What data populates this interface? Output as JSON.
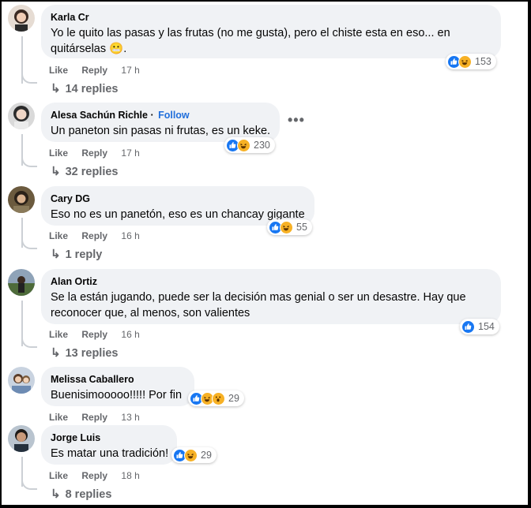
{
  "comments": [
    {
      "author": "Karla Cr",
      "text_line1": "Yo le quito las pasas y las frutas (no me gusta), pero el chiste esta en eso... en",
      "text_line2": "quitárselas 😬.",
      "like_label": "Like",
      "reply_label": "Reply",
      "time": "17 h",
      "reaction_count": "153",
      "reactions": [
        "like-icon",
        "haha-icon"
      ],
      "replies_label": "14 replies"
    },
    {
      "author": "Alesa Sachún Richle",
      "follow_label": "Follow",
      "text_line1": "Un paneton sin pasas ni frutas, es un keke.",
      "like_label": "Like",
      "reply_label": "Reply",
      "time": "17 h",
      "reaction_count": "230",
      "reactions": [
        "like-icon",
        "haha-icon"
      ],
      "replies_label": "32 replies",
      "more_label": "•••"
    },
    {
      "author": "Cary DG",
      "text_line1": "Eso no es un panetón, eso es un chancay gigante",
      "like_label": "Like",
      "reply_label": "Reply",
      "time": "16 h",
      "reaction_count": "55",
      "reactions": [
        "like-icon",
        "haha-icon"
      ],
      "replies_label": "1 reply"
    },
    {
      "author": "Alan Ortiz",
      "text_line1": "Se la están jugando, puede ser la decisión mas genial o ser un desastre. Hay que",
      "text_line2": "reconocer que, al menos, son valientes",
      "like_label": "Like",
      "reply_label": "Reply",
      "time": "16 h",
      "reaction_count": "154",
      "reactions": [
        "like-icon"
      ],
      "replies_label": "13 replies"
    },
    {
      "author": "Melissa Caballero",
      "text_line1": "Buenisimooooo!!!!! Por fin",
      "like_label": "Like",
      "reply_label": "Reply",
      "time": "13 h",
      "reaction_count": "29",
      "reactions": [
        "like-icon",
        "haha-icon",
        "wow-icon"
      ]
    },
    {
      "author": "Jorge Luis",
      "text_line1": "Es matar una tradición!",
      "like_label": "Like",
      "reply_label": "Reply",
      "time": "18 h",
      "reaction_count": "29",
      "reactions": [
        "like-icon",
        "haha-icon"
      ],
      "replies_label": "8 replies"
    }
  ],
  "colors": {
    "bubble": "#f0f2f5",
    "like_blue": "#1877f2",
    "haha_yellow": "#f7b125",
    "follow_blue": "#216fdb",
    "secondary_text": "#65676b"
  }
}
